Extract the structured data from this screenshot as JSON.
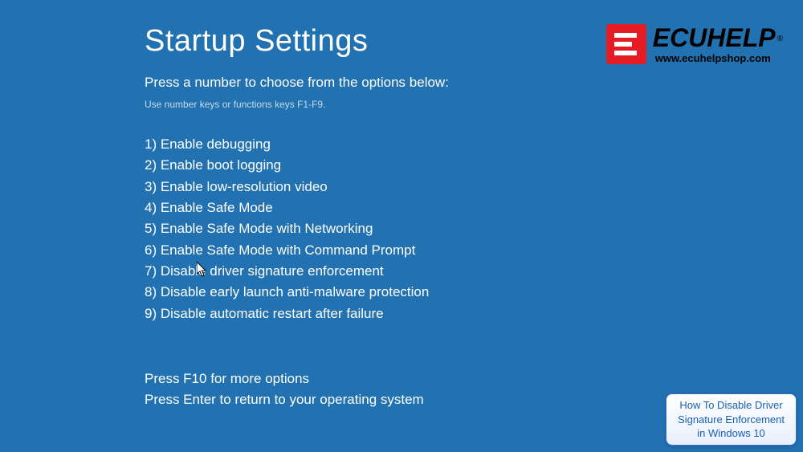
{
  "title": "Startup Settings",
  "subtitle": "Press a number to choose from the options below:",
  "hint": "Use number keys or functions keys F1-F9.",
  "options": [
    "1) Enable debugging",
    "2) Enable boot logging",
    "3) Enable low-resolution video",
    "4) Enable Safe Mode",
    "5) Enable Safe Mode with Networking",
    "6) Enable Safe Mode with Command Prompt",
    "7) Disable driver signature enforcement",
    "8) Disable early launch anti-malware protection",
    "9) Disable automatic restart after failure"
  ],
  "footer": [
    "Press F10 for more options",
    "Press Enter to return to your operating system"
  ],
  "logo": {
    "brand": "ECUHELP",
    "url": "www.ecuhelpshop.com"
  },
  "infobox": {
    "line1": "How To Disable Driver",
    "line2": "Signature Enforcement",
    "line3": "in Windows 10"
  }
}
